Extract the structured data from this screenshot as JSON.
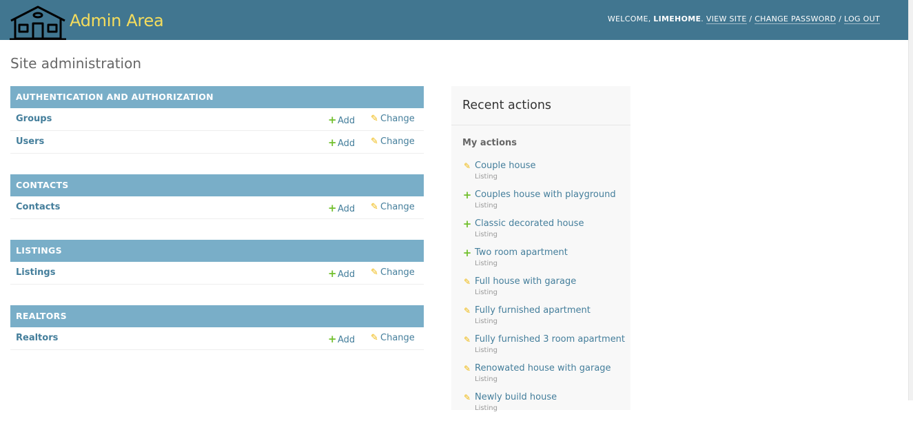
{
  "header": {
    "brand": "Admin Area",
    "welcome": "WELCOME,",
    "username": "LIMEHOME",
    "view_site": "VIEW SITE",
    "change_password": "CHANGE PASSWORD",
    "log_out": "LOG OUT",
    "separator": "/"
  },
  "page": {
    "title": "Site administration"
  },
  "modules": [
    {
      "caption": "AUTHENTICATION AND AUTHORIZATION",
      "models": [
        {
          "name": "Groups"
        },
        {
          "name": "Users"
        }
      ]
    },
    {
      "caption": "CONTACTS",
      "models": [
        {
          "name": "Contacts"
        }
      ]
    },
    {
      "caption": "LISTINGS",
      "models": [
        {
          "name": "Listings"
        }
      ]
    },
    {
      "caption": "REALTORS",
      "models": [
        {
          "name": "Realtors"
        }
      ]
    }
  ],
  "links": {
    "add": "Add",
    "change": "Change"
  },
  "recent": {
    "title": "Recent actions",
    "subtitle": "My actions",
    "items": [
      {
        "title": "Couple house",
        "type": "Listing",
        "icon": "change"
      },
      {
        "title": "Couples house with playground",
        "type": "Listing",
        "icon": "add"
      },
      {
        "title": "Classic decorated house",
        "type": "Listing",
        "icon": "add"
      },
      {
        "title": "Two room apartment",
        "type": "Listing",
        "icon": "add"
      },
      {
        "title": "Full house with garage",
        "type": "Listing",
        "icon": "change"
      },
      {
        "title": "Fully furnished apartment",
        "type": "Listing",
        "icon": "change"
      },
      {
        "title": "Fully furnished 3 room apartment",
        "type": "Listing",
        "icon": "change"
      },
      {
        "title": "Renowated house with garage",
        "type": "Listing",
        "icon": "change"
      },
      {
        "title": "Newly build house",
        "type": "Listing",
        "icon": "change"
      }
    ]
  },
  "colors": {
    "header_bg": "#417690",
    "brand": "#f5dd5d",
    "caption_bg": "#79aec8",
    "link": "#447e9b",
    "add_icon": "#70bf2b",
    "change_icon": "#efb80b"
  },
  "icons": {
    "logo": "house-logo-icon",
    "add": "plus-icon",
    "change": "pencil-icon"
  }
}
